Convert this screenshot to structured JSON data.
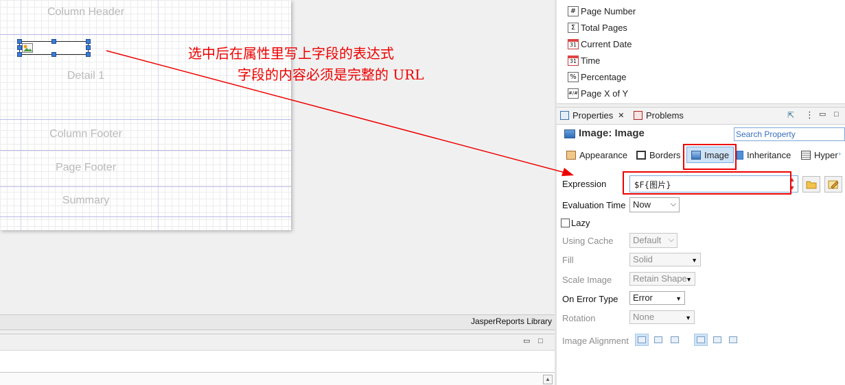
{
  "designer": {
    "bands": [
      "Column Header",
      "Detail 1",
      "Column Footer",
      "Page Footer",
      "Summary"
    ]
  },
  "annotation": {
    "line1": "选中后在属性里写上字段的表达式",
    "line2": "字段的内容必须是完整的 URL",
    "color": "#ee0000"
  },
  "bottom": {
    "library_tab": "JasperReports Library"
  },
  "palette": {
    "items": [
      {
        "icon": "hash-icon",
        "glyph": "#",
        "label": "Page Number"
      },
      {
        "icon": "sigma-icon",
        "glyph": "Σ",
        "label": "Total Pages"
      },
      {
        "icon": "calendar-icon",
        "glyph": "31",
        "label": "Current Date"
      },
      {
        "icon": "calendar-icon",
        "glyph": "31",
        "label": "Time"
      },
      {
        "icon": "percent-icon",
        "glyph": "%",
        "label": "Percentage"
      },
      {
        "icon": "page-x-of-y-icon",
        "glyph": "#/#",
        "label": "Page X of Y"
      }
    ]
  },
  "properties": {
    "tabs": [
      {
        "label": "Properties",
        "icon": "properties-icon"
      },
      {
        "label": "Problems",
        "icon": "problems-icon"
      }
    ],
    "title": "Image: Image",
    "search_placeholder": "Search Property",
    "section_tabs": [
      {
        "label": "Appearance",
        "icon": "appearance-icon"
      },
      {
        "label": "Borders",
        "icon": "borders-icon"
      },
      {
        "label": "Image",
        "icon": "image-icon",
        "active": true
      },
      {
        "label": "Inheritance",
        "icon": "inheritance-icon"
      },
      {
        "label": "Hyper",
        "icon": "hyperlink-icon"
      }
    ],
    "expression": {
      "label": "Expression",
      "value": "$F{图片}"
    },
    "evaluation_time": {
      "label": "Evaluation Time",
      "value": "Now"
    },
    "lazy": {
      "label": "Lazy",
      "checked": false
    },
    "using_cache": {
      "label": "Using Cache",
      "value": "Default"
    },
    "fill": {
      "label": "Fill",
      "value": "Solid"
    },
    "scale_image": {
      "label": "Scale Image",
      "value": "Retain Shape"
    },
    "on_error_type": {
      "label": "On Error Type",
      "value": "Error"
    },
    "rotation": {
      "label": "Rotation",
      "value": "None"
    },
    "image_alignment": {
      "label": "Image Alignment"
    }
  }
}
